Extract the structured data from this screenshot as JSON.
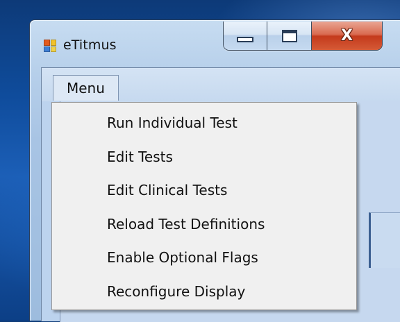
{
  "window": {
    "title": "eTitmus",
    "icon": "app-window-icon",
    "caption_buttons": {
      "minimize_icon": "minimize-icon",
      "maximize_icon": "maximize-icon",
      "close_label": "X"
    }
  },
  "menubar": {
    "items": [
      {
        "label": "Menu",
        "open": true
      }
    ]
  },
  "dropdown": {
    "items": [
      {
        "label": "Run Individual Test"
      },
      {
        "label": "Edit Tests"
      },
      {
        "label": "Edit Clinical Tests"
      },
      {
        "label": "Reload Test Definitions"
      },
      {
        "label": "Enable Optional Flags"
      },
      {
        "label": "Reconfigure Display"
      }
    ]
  },
  "colors": {
    "desktop": "#0f4c9c",
    "frame": "#b6cfea",
    "close_button": "#c43a1c",
    "menu_background": "#f0f0f0"
  }
}
